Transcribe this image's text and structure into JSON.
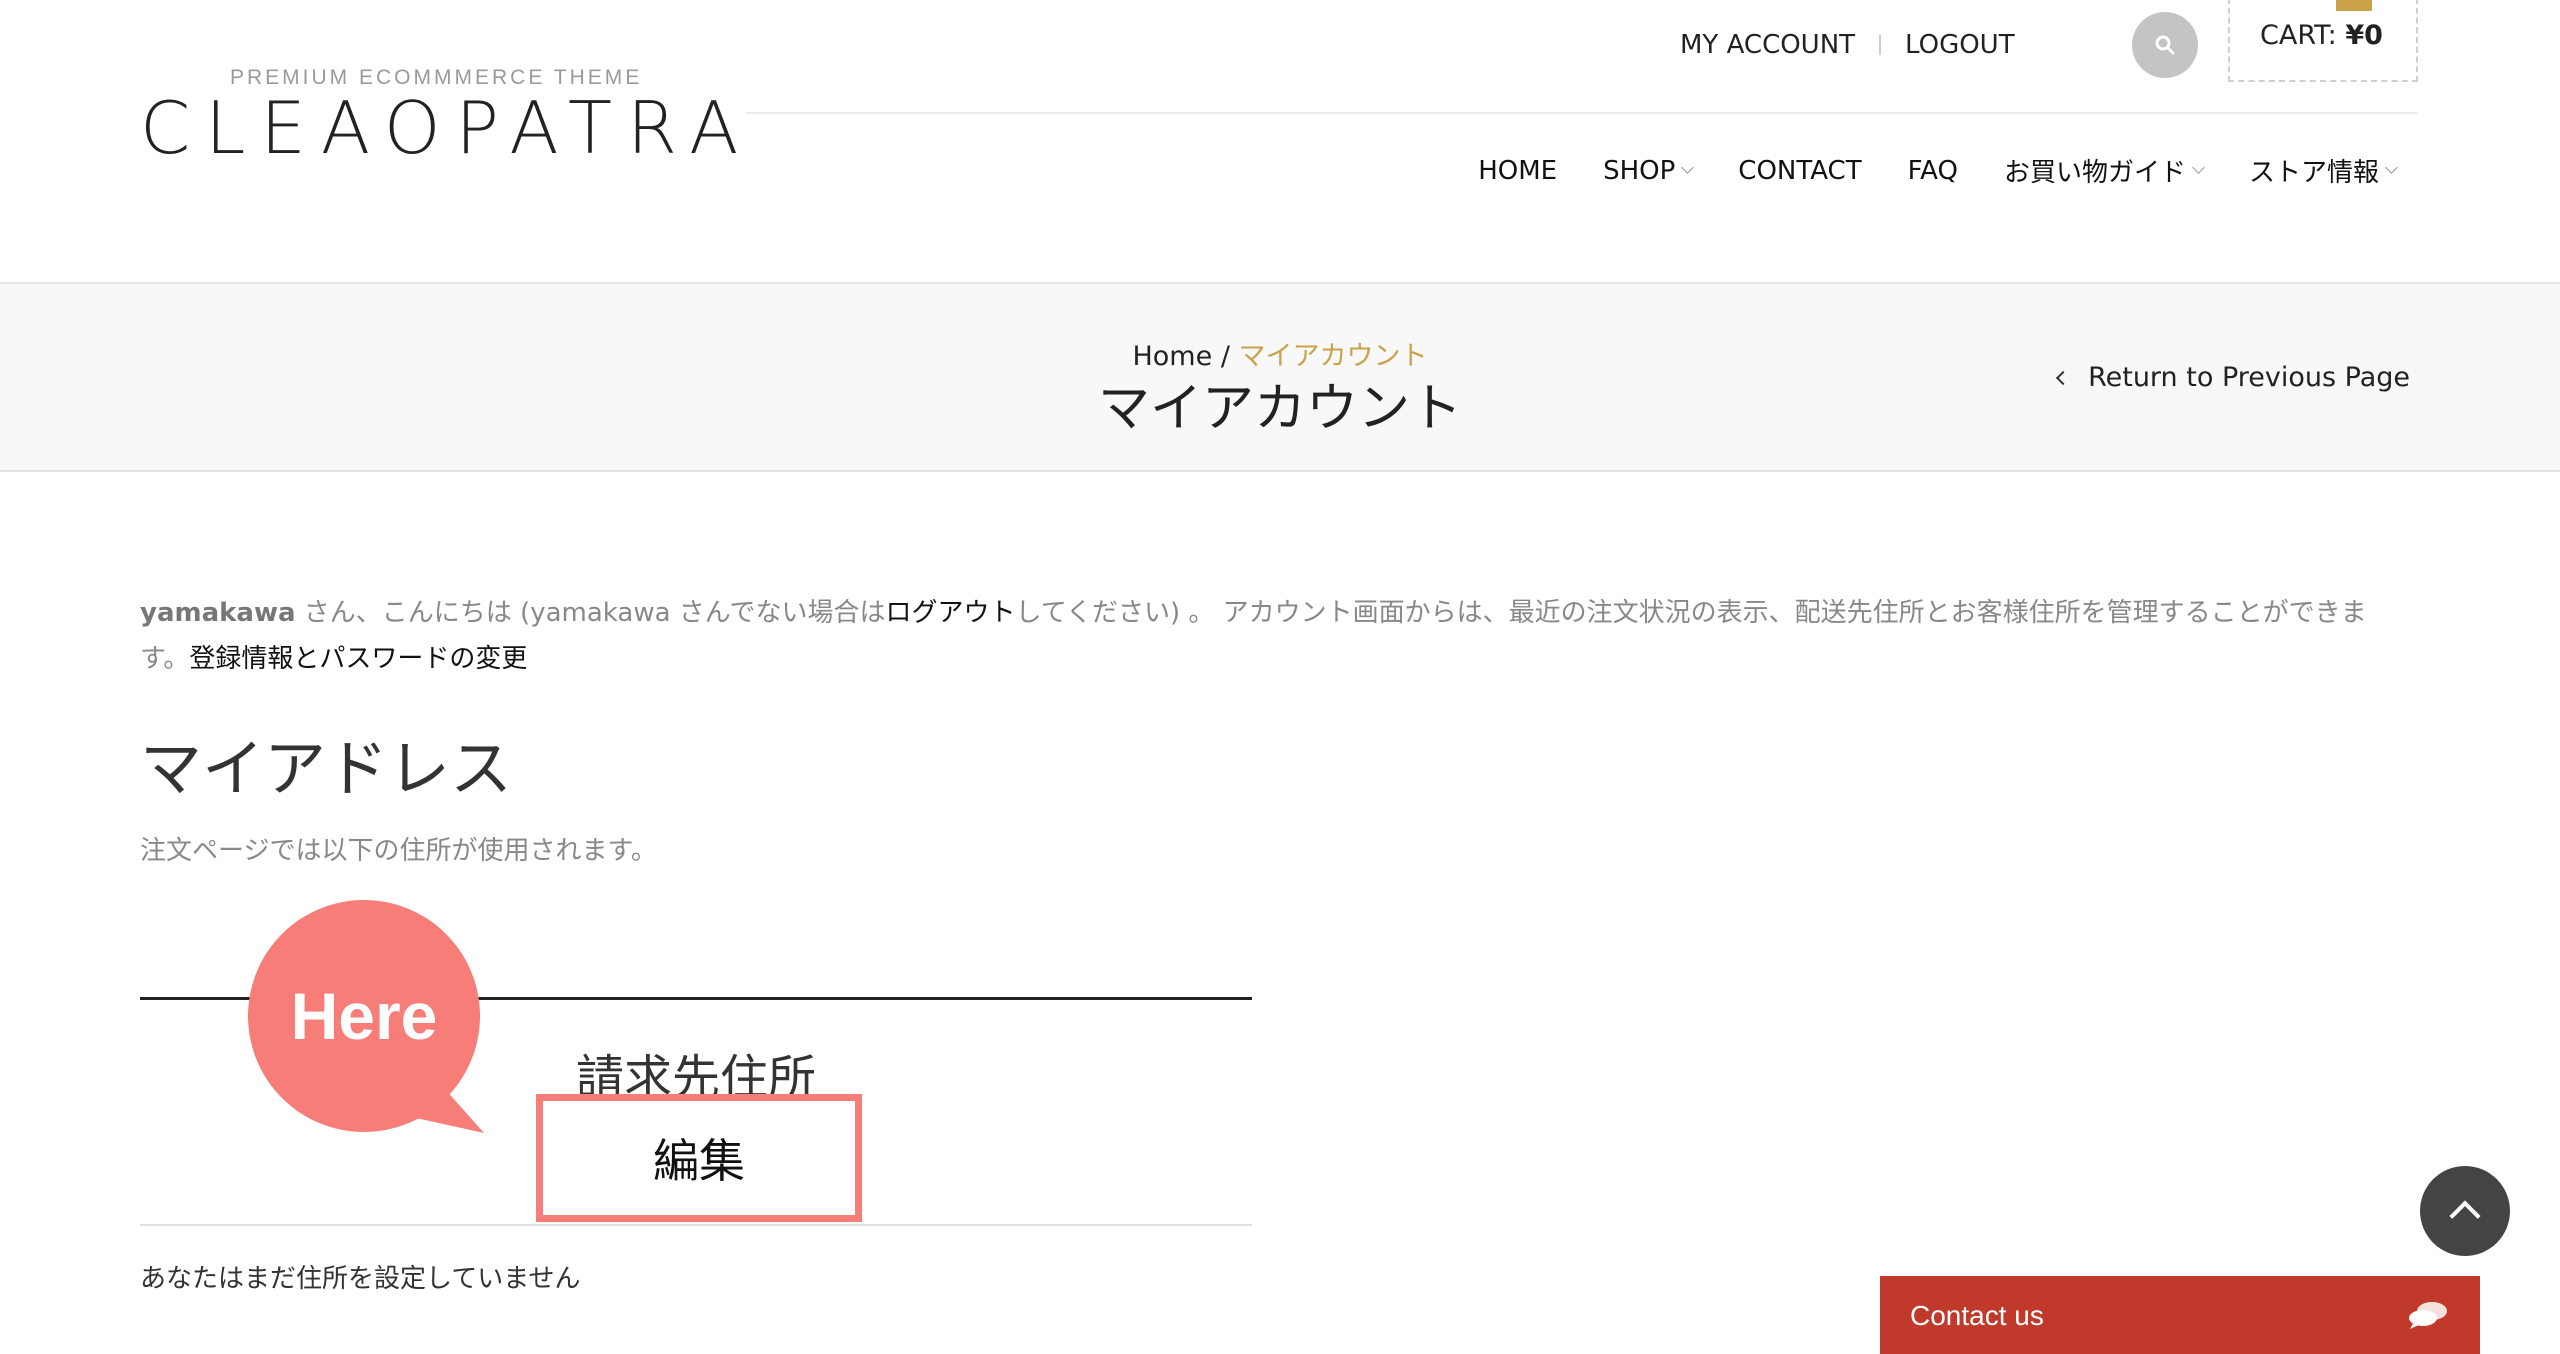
{
  "header": {
    "logo_tagline": "PREMIUM ECOMMMERCE THEME",
    "logo_name": "CLEAOPATRA",
    "top_links": {
      "account": "MY ACCOUNT",
      "logout": "LOGOUT"
    },
    "cart_label": "CART:",
    "cart_amount": "¥0",
    "nav": {
      "home": "HOME",
      "shop": "SHOP",
      "contact": "CONTACT",
      "faq": "FAQ",
      "guide": "お買い物ガイド",
      "store": "ストア情報"
    }
  },
  "breadcrumb": {
    "home": "Home",
    "separator": "/",
    "current": "マイアカウント"
  },
  "page_title": "マイアカウント",
  "return_link": "Return to Previous Page",
  "intro": {
    "user": "yamakawa",
    "text1": " さん、こんにちは (yamakawa さんでない場合は",
    "logout_link": "ログアウト",
    "text2": "してください) 。 アカウント画面からは、最近の注文状況の表示、配送先住所とお客様住所を管理することができます。",
    "edit_link": "登録情報とパスワードの変更"
  },
  "addresses": {
    "heading": "マイアドレス",
    "description": "注文ページでは以下の住所が使用されます。",
    "billing_title": "請求先住所",
    "edit_button": "編集",
    "empty_message": "あなたはまだ住所を設定していません"
  },
  "annotation": {
    "label": "Here",
    "color": "#f67d78"
  },
  "contact_widget": {
    "label": "Contact us",
    "color": "#c0392b"
  },
  "colors": {
    "accent": "#c9a24a"
  }
}
